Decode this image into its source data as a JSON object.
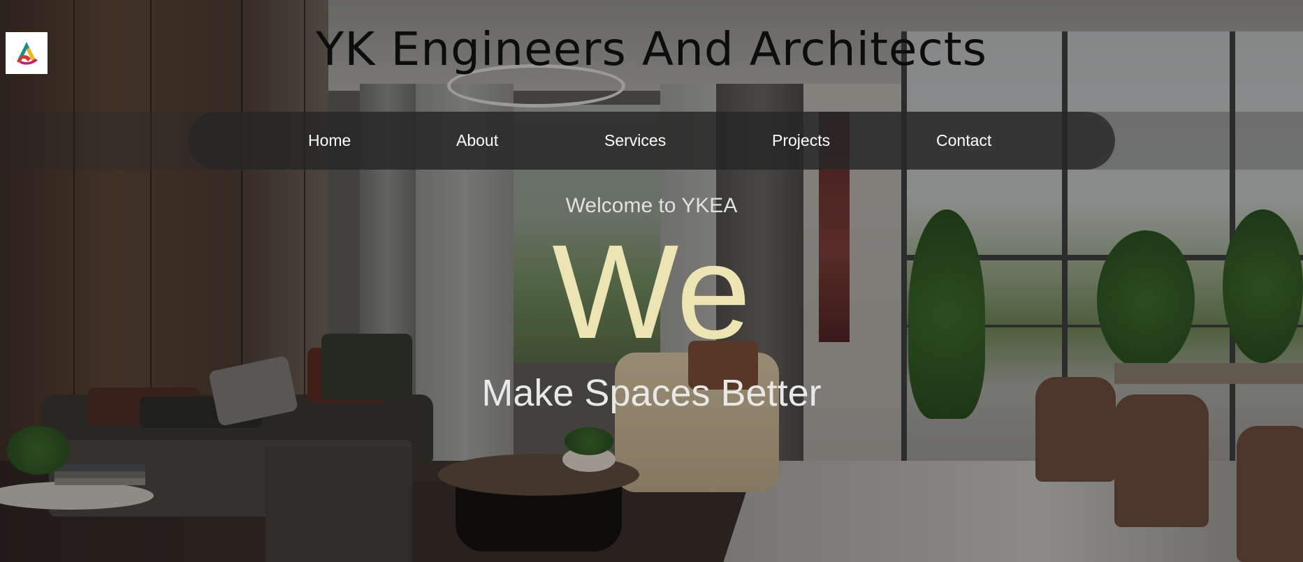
{
  "header": {
    "logo_icon": "ykea-logo-icon",
    "title": "YK Engineers And Architects"
  },
  "nav": {
    "items": [
      {
        "label": "Home"
      },
      {
        "label": "About"
      },
      {
        "label": "Services"
      },
      {
        "label": "Projects"
      },
      {
        "label": "Contact"
      }
    ]
  },
  "hero": {
    "welcome": "Welcome to YKEA",
    "headline": "We",
    "tagline": "Make Spaces Better"
  },
  "colors": {
    "headline": "#ece5b3",
    "nav_bar": "#262626",
    "title": "#0d0d0d"
  }
}
